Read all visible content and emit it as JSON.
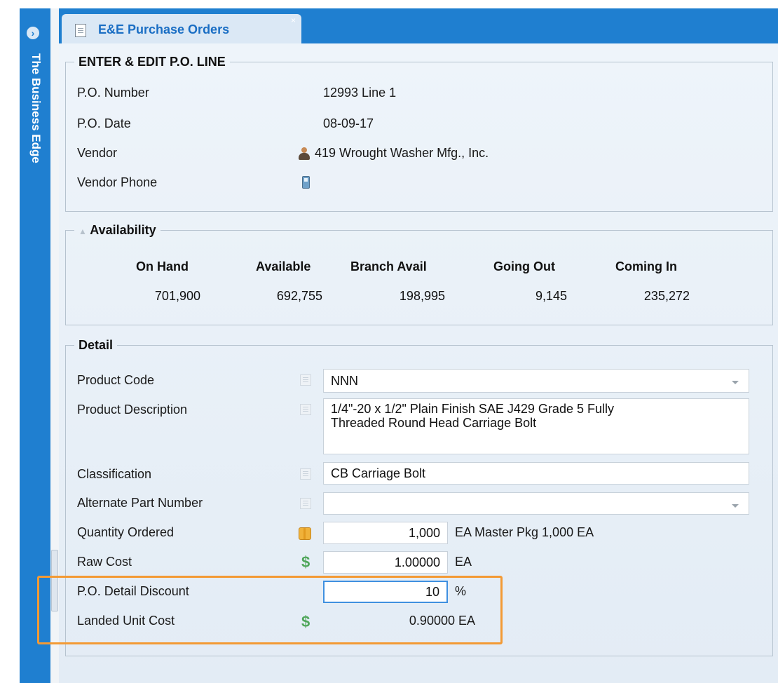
{
  "app": {
    "brand": "The Business Edge"
  },
  "tab": {
    "title": "E&E Purchase Orders",
    "close": "×"
  },
  "po_line": {
    "legend": "ENTER & EDIT P.O. LINE",
    "po_number_label": "P.O. Number",
    "po_number": "12993 Line 1",
    "po_date_label": "P.O. Date",
    "po_date": "08-09-17",
    "vendor_label": "Vendor",
    "vendor": "419 Wrought Washer Mfg., Inc.",
    "vendor_phone_label": "Vendor Phone",
    "vendor_phone": ""
  },
  "availability": {
    "legend": "Availability",
    "columns": [
      {
        "label": "On Hand",
        "value": "701,900"
      },
      {
        "label": "Available",
        "value": "692,755"
      },
      {
        "label": "Branch Avail",
        "value": "198,995"
      },
      {
        "label": "Going Out",
        "value": "9,145"
      },
      {
        "label": "Coming In",
        "value": "235,272"
      }
    ]
  },
  "detail": {
    "legend": "Detail",
    "product_code_label": "Product Code",
    "product_code": "NNN",
    "product_description_label": "Product Description",
    "product_description_line1": "1/4\"-20 x 1/2\" Plain Finish SAE J429 Grade 5 Fully",
    "product_description_line2": "Threaded Round Head Carriage Bolt",
    "classification_label": "Classification",
    "classification": "CB Carriage Bolt",
    "alternate_part_number_label": "Alternate Part Number",
    "alternate_part_number": "",
    "quantity_ordered_label": "Quantity Ordered",
    "quantity_ordered": "1,000",
    "quantity_unit": "EA Master Pkg 1,000 EA",
    "raw_cost_label": "Raw Cost",
    "raw_cost": "1.00000",
    "raw_cost_unit": "EA",
    "discount_label": "P.O. Detail Discount",
    "discount": "10",
    "discount_unit": "%",
    "landed_unit_cost_label": "Landed Unit Cost",
    "landed_unit_cost": "0.90000 EA"
  },
  "icons": {
    "tab": "document-icon",
    "vendor": "person-icon",
    "phone": "phone-icon",
    "list": "list-icon",
    "quantity": "box-icon",
    "cost": "dollar-icon"
  },
  "colors": {
    "accent": "#1f7fd0",
    "highlight": "#f39a34",
    "dollar": "#4fa65a"
  }
}
